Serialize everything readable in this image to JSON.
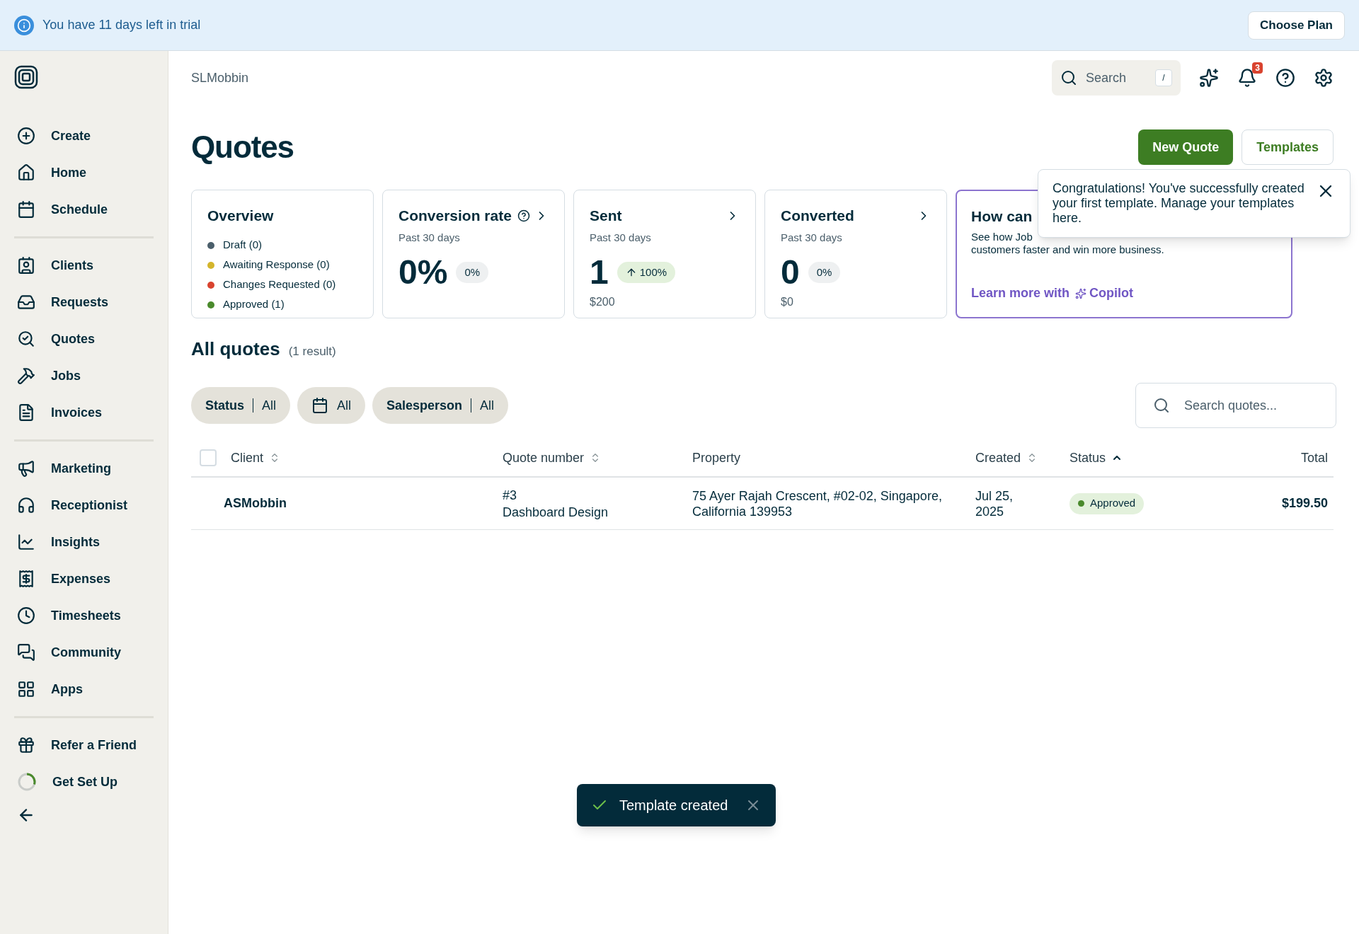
{
  "trial_banner": {
    "message": "You have 11 days left in trial",
    "button": "Choose Plan"
  },
  "sidebar": {
    "groups": [
      [
        {
          "label": "Create"
        },
        {
          "label": "Home"
        },
        {
          "label": "Schedule"
        }
      ],
      [
        {
          "label": "Clients"
        },
        {
          "label": "Requests"
        },
        {
          "label": "Quotes"
        },
        {
          "label": "Jobs"
        },
        {
          "label": "Invoices"
        }
      ],
      [
        {
          "label": "Marketing"
        },
        {
          "label": "Receptionist"
        },
        {
          "label": "Insights"
        },
        {
          "label": "Expenses"
        },
        {
          "label": "Timesheets"
        },
        {
          "label": "Community"
        },
        {
          "label": "Apps"
        }
      ],
      [
        {
          "label": "Refer a Friend"
        },
        {
          "label": "Get Set Up",
          "kind": "progress",
          "level": 0.3
        }
      ]
    ]
  },
  "header": {
    "account": "SLMobbin",
    "search": {
      "placeholder": "Search",
      "shortcut": "/"
    },
    "notifications": "3"
  },
  "page": {
    "title": "Quotes",
    "buttons": [
      {
        "label": "New Quote",
        "kind": "primary"
      },
      {
        "label": "Templates",
        "kind": "secondary"
      }
    ]
  },
  "overview": {
    "title": "Overview",
    "statuses": [
      {
        "label": "Draft (0)",
        "color": "#4b5f6b"
      },
      {
        "label": "Awaiting Response (0)",
        "color": "#d4b52c"
      },
      {
        "label": "Changes Requested (0)",
        "color": "#d9432f"
      },
      {
        "label": "Approved (1)",
        "color": "#4a8a2c"
      }
    ]
  },
  "stat_cards": [
    {
      "title": "Conversion rate",
      "help": true,
      "subtitle": "Past 30 days",
      "value": "0%",
      "change": "0%",
      "rising": false
    },
    {
      "title": "Sent",
      "help": false,
      "subtitle": "Past 30 days",
      "value": "1",
      "change": "100%",
      "rising": true,
      "amount": "$200"
    },
    {
      "title": "Converted",
      "help": false,
      "subtitle": "Past 30 days",
      "value": "0",
      "change": "0%",
      "rising": false,
      "amount": "$0"
    }
  ],
  "copilot_card": {
    "title": "How can",
    "text_1": "See how Job",
    "text_2": "customers faster and win more business.",
    "link_prefix": "Learn more with",
    "link_name": "Copilot"
  },
  "popover": {
    "message": "Congratulations! You've successfully created your first template. Manage your templates here."
  },
  "all_quotes": {
    "title": "All quotes",
    "count": "(1 result)",
    "filters": [
      {
        "label": "Status",
        "value": "All",
        "kind": "labeled"
      },
      {
        "value": "All",
        "kind": "date"
      },
      {
        "label": "Salesperson",
        "value": "All",
        "kind": "labeled"
      }
    ],
    "search": {
      "placeholder": "Search quotes..."
    },
    "table": {
      "select_all_checked": false,
      "columns": [
        {
          "label": "Client",
          "kind": "sortable"
        },
        {
          "label": "Quote number",
          "kind": "sortable"
        },
        {
          "label": "Property",
          "kind": "plain"
        },
        {
          "label": "Created",
          "kind": "sortable"
        },
        {
          "label": "Status",
          "kind": "sorted"
        },
        {
          "label": "Total",
          "kind": "plain"
        }
      ],
      "rows": [
        {
          "client": "ASMobbin",
          "quote_number": "#3",
          "quote_title": "Dashboard Design",
          "property": "75 Ayer Rajah Crescent, #02-02, Singapore, California 139953",
          "created": "Jul 25, 2025",
          "status": "Approved",
          "color": "#4a8a2c",
          "total": "$199.50"
        }
      ]
    }
  },
  "toast": {
    "message": "Template created"
  }
}
